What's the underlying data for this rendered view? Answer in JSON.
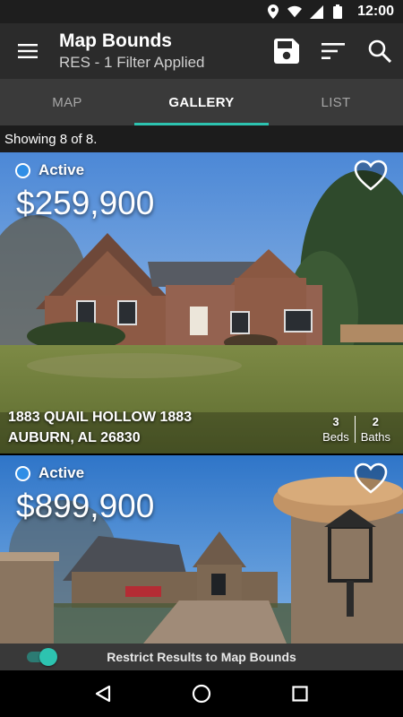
{
  "status_bar": {
    "time": "12:00",
    "icons": [
      "location-icon",
      "wifi-icon",
      "signal-icon",
      "battery-icon"
    ]
  },
  "app_bar": {
    "title": "Map Bounds",
    "subtitle": "RES - 1 Filter Applied",
    "icons": [
      "menu-icon",
      "save-icon",
      "sort-icon",
      "search-icon"
    ]
  },
  "tabs": [
    {
      "label": "MAP",
      "active": false
    },
    {
      "label": "GALLERY",
      "active": true
    },
    {
      "label": "LIST",
      "active": false
    }
  ],
  "showing_text": "Showing 8 of 8.",
  "listings": [
    {
      "status": "Active",
      "price": "$259,900",
      "address_line1": "1883 QUAIL HOLLOW 1883",
      "address_line2": "AUBURN, AL 26830",
      "beds": "3",
      "beds_label": "Beds",
      "baths": "2",
      "baths_label": "Baths",
      "favorite_icon": "heart-outline-icon"
    },
    {
      "status": "Active",
      "price": "$899,900",
      "favorite_icon": "heart-outline-icon"
    }
  ],
  "restrict_bar": {
    "label": "Restrict Results to Map Bounds",
    "toggle_on": true
  },
  "nav_bar": {
    "icons": [
      "back-icon",
      "home-icon",
      "recents-icon"
    ]
  },
  "colors": {
    "accent": "#2dc3b0",
    "status_active": "#2f8ee6",
    "app_bar": "#2b2b2b",
    "tab_bar": "#3a3a3a"
  }
}
